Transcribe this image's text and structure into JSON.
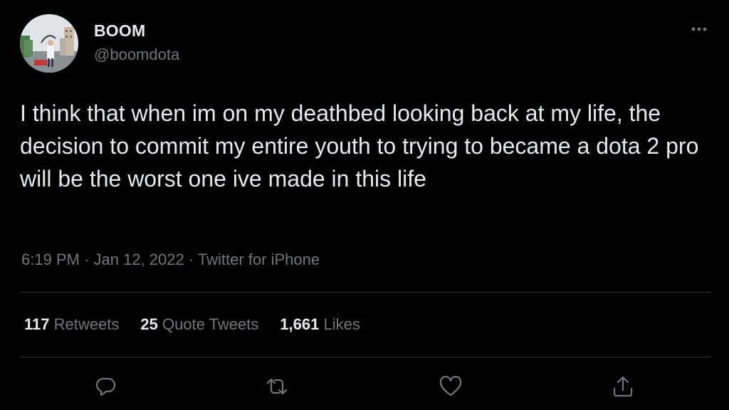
{
  "tweet": {
    "author": {
      "display_name": "BOOM",
      "handle": "@boomdota",
      "avatar_icon": "profile-photo"
    },
    "more_icon": "more-horizontal-icon",
    "text": "I think that when im on my deathbed looking back at my life, the decision to commit my entire youth to trying to became a dota 2 pro will be the worst one ive made in this life",
    "meta": {
      "time": "6:19 PM",
      "separator_1": " · ",
      "date": "Jan 12, 2022",
      "separator_2": " · ",
      "source": "Twitter for iPhone"
    },
    "stats": {
      "retweets": {
        "count": "117",
        "label": "Retweets"
      },
      "quote_tweets": {
        "count": "25",
        "label": "Quote Tweets"
      },
      "likes": {
        "count": "1,661",
        "label": "Likes"
      }
    },
    "actions": [
      "reply-icon",
      "retweet-icon",
      "like-icon",
      "share-icon"
    ]
  },
  "colors": {
    "background": "#000000",
    "primary_text": "#e7e9ea",
    "secondary_text": "#71767b",
    "divider": "#2f3336"
  }
}
